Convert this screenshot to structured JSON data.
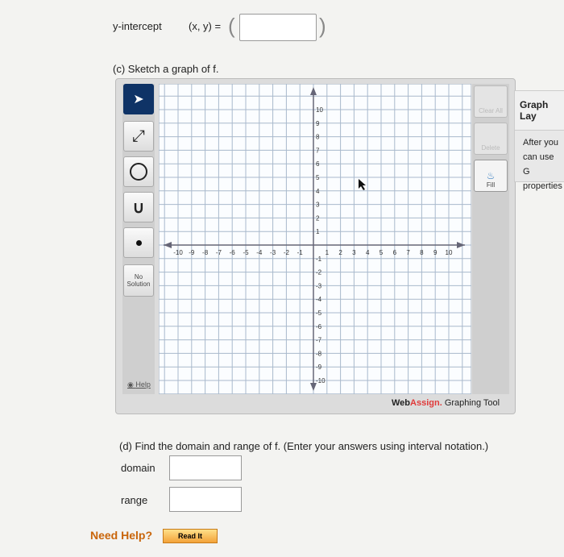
{
  "yintercept": {
    "label": "y-intercept",
    "expr": "(x, y) =",
    "open": "(",
    "close": ")",
    "value": ""
  },
  "part_c": "(c) Sketch a graph of f.",
  "tools": {
    "no_solution": "No Solution",
    "help": "Help",
    "clear_all": "Clear All",
    "delete": "Delete",
    "fill": "Fill"
  },
  "brand": {
    "web": "Web",
    "assign": "Assign.",
    "suffix": "Graphing Tool",
    "accent": "#e03a3a"
  },
  "graph": {
    "xmin": -10,
    "xmax": 10,
    "ymin": -10,
    "ymax": 10,
    "grid": true
  },
  "side_panel": {
    "title": "Graph Lay",
    "lines": [
      "After you",
      "can use G",
      "properties"
    ]
  },
  "part_d": "(d) Find the domain and range of f. (Enter your answers using interval notation.)",
  "domain": {
    "label": "domain",
    "value": ""
  },
  "range": {
    "label": "range",
    "value": ""
  },
  "help": {
    "label": "Need Help?",
    "read": "Read It"
  }
}
